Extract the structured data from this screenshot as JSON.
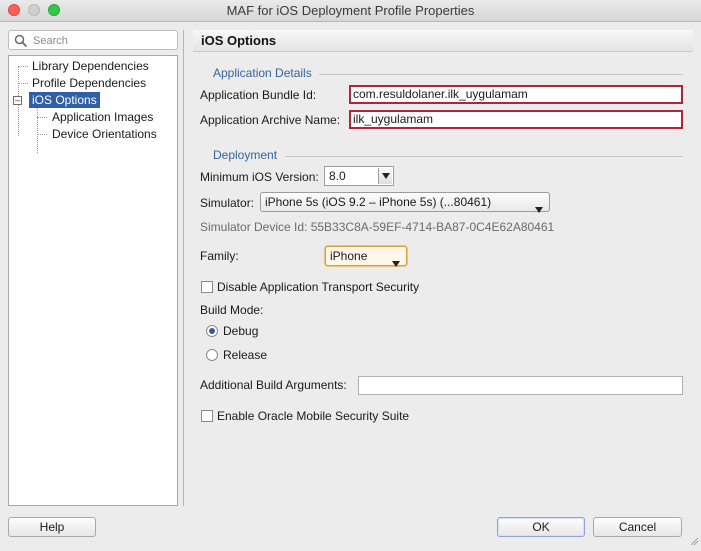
{
  "window": {
    "title": "MAF for iOS Deployment Profile Properties"
  },
  "search": {
    "placeholder": "Search",
    "value": ""
  },
  "tree": {
    "items": [
      {
        "label": "Library Dependencies"
      },
      {
        "label": "Profile Dependencies"
      },
      {
        "label": "iOS Options",
        "selected": true
      },
      {
        "label": "Application Images"
      },
      {
        "label": "Device Orientations"
      }
    ]
  },
  "page": {
    "title": "iOS Options"
  },
  "application_details": {
    "section_title": "Application Details",
    "bundle_id_label": "Application Bundle Id:",
    "bundle_id_value": "com.resuldolaner.ilk_uygulamam",
    "archive_name_label": "Application Archive Name:",
    "archive_name_value": "ilk_uygulamam"
  },
  "deployment": {
    "section_title": "Deployment",
    "min_ios_label": "Minimum iOS Version:",
    "min_ios_value": "8.0",
    "simulator_label": "Simulator:",
    "simulator_value": "iPhone 5s (iOS 9.2 – iPhone 5s) (...80461)",
    "simulator_device_id": "Simulator Device Id: 55B33C8A-59EF-4714-BA87-0C4E62A80461",
    "family_label": "Family:",
    "family_value": "iPhone",
    "disable_ats_label": "Disable Application Transport Security",
    "disable_ats_checked": false,
    "build_mode_label": "Build Mode:",
    "build_mode_options": [
      {
        "label": "Debug",
        "checked": true
      },
      {
        "label": "Release",
        "checked": false
      }
    ],
    "additional_args_label": "Additional Build Arguments:",
    "additional_args_value": "",
    "oracle_security_label": "Enable Oracle Mobile Security Suite",
    "oracle_security_checked": false
  },
  "buttons": {
    "help": "Help",
    "ok": "OK",
    "cancel": "Cancel"
  },
  "colors": {
    "accent": "#2e5fa8",
    "section_title": "#35659b",
    "error_border": "#b3243b"
  }
}
